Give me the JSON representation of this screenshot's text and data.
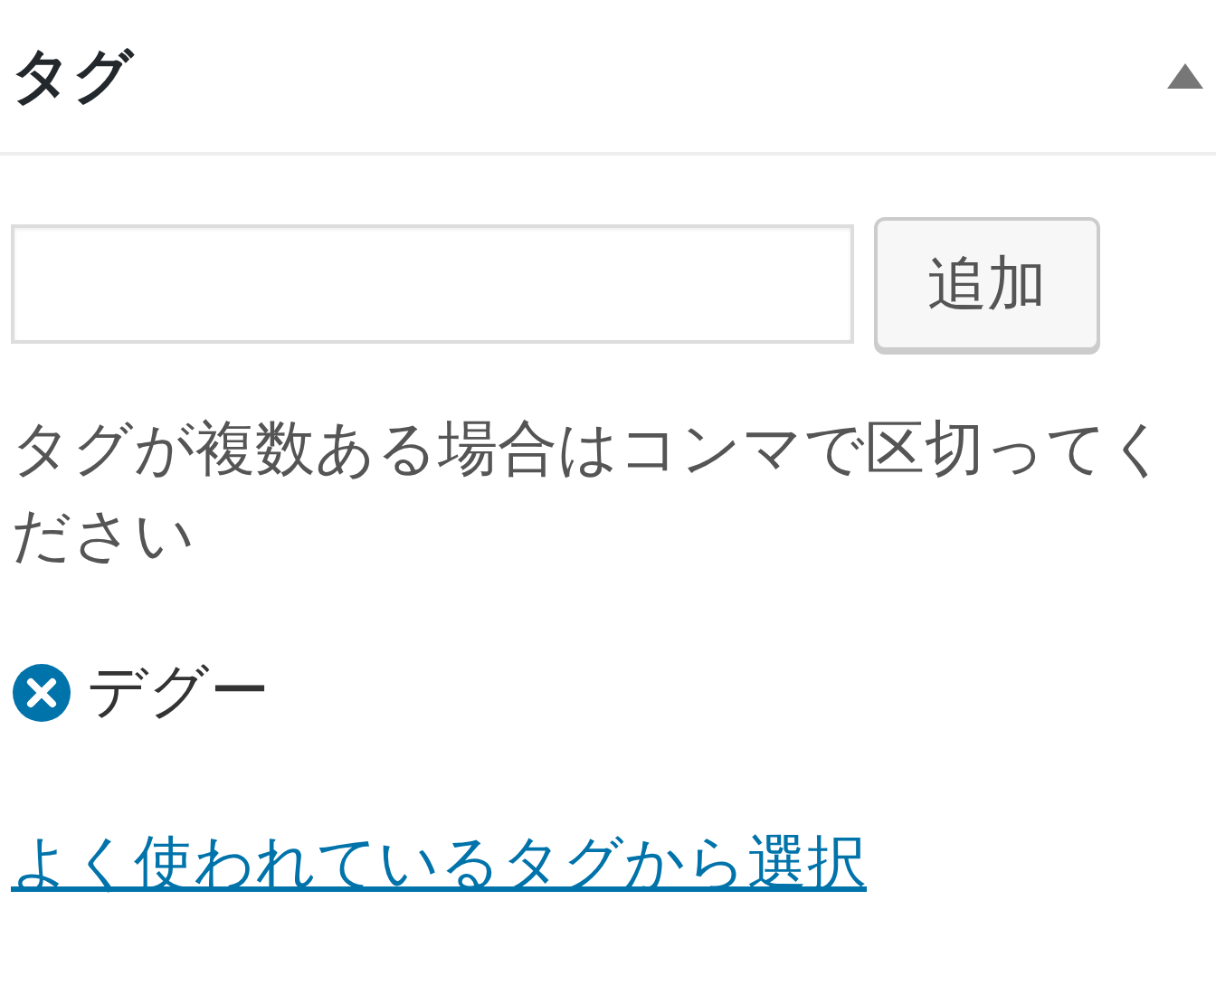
{
  "panel": {
    "title": "タグ",
    "expanded": true
  },
  "add_button": "追加",
  "help": "タグが複数ある場合はコンマで区切ってください",
  "tags": [
    {
      "label": "デグー"
    }
  ],
  "link": "よく使われているタグから選択"
}
